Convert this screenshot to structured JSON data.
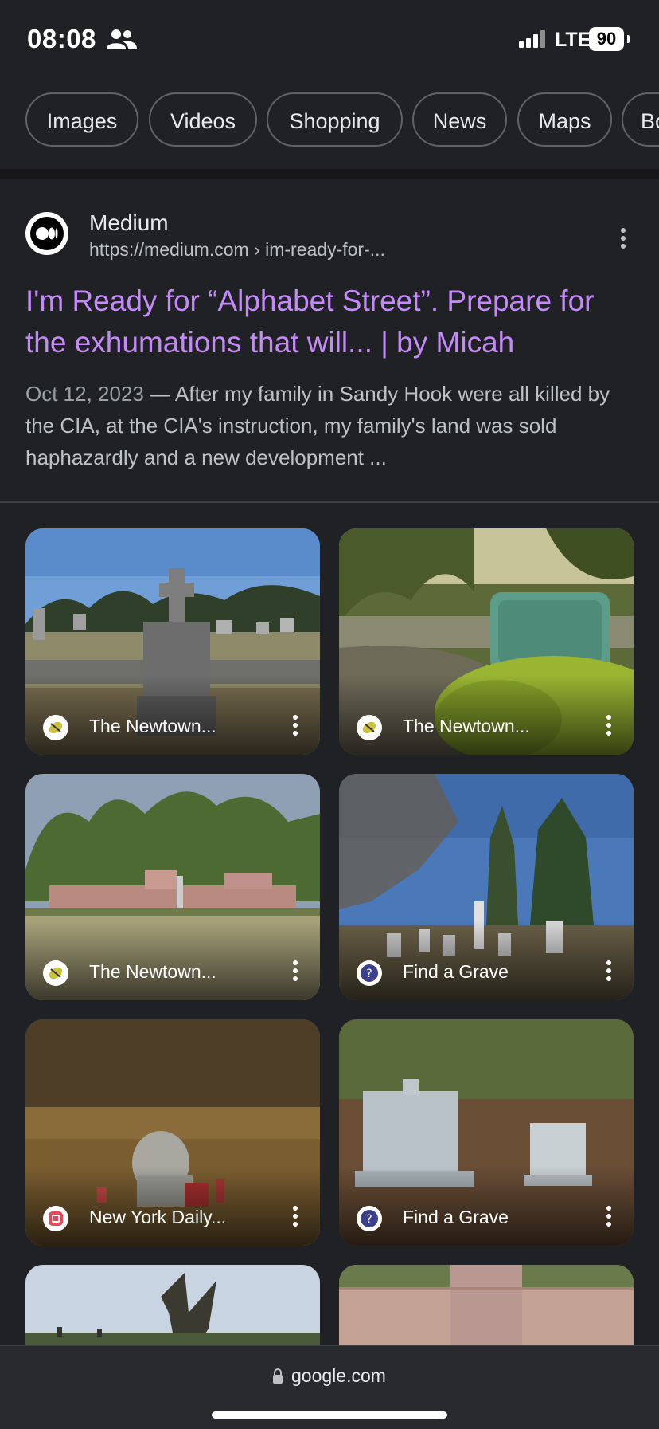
{
  "status_bar": {
    "time": "08:08",
    "network": "LTE",
    "battery": "90",
    "icons": [
      "people-icon",
      "signal-icon",
      "battery-icon"
    ]
  },
  "filter_chips": [
    "Images",
    "Videos",
    "Shopping",
    "News",
    "Maps",
    "Books"
  ],
  "result": {
    "site_name": "Medium",
    "site_url": "https://medium.com › im-ready-for-...",
    "title": "I'm Ready for “Alphabet Street”. Prepare for the exhumations that will... | by Micah",
    "date": "Oct 12, 2023",
    "snippet": " — After my family in Sandy Hook were all killed by the CIA, at the CIA's instruction, my family's land was sold haphazardly and a new development ...",
    "icons": [
      "medium-logo-icon",
      "more-vert-icon"
    ]
  },
  "images": [
    {
      "source": "The Newtown...",
      "icon": "newtown-bee-icon"
    },
    {
      "source": "The Newtown...",
      "icon": "newtown-bee-icon"
    },
    {
      "source": "The Newtown...",
      "icon": "newtown-bee-icon"
    },
    {
      "source": "Find a Grave",
      "icon": "find-a-grave-icon"
    },
    {
      "source": "New York Daily...",
      "icon": "ny-daily-news-icon"
    },
    {
      "source": "Find a Grave",
      "icon": "find-a-grave-icon"
    }
  ],
  "bottom_bar": {
    "url": "google.com",
    "icon": "lock-icon"
  },
  "colors": {
    "background": "#202124",
    "link_visited": "#c58af9",
    "snippet": "#bdc1c6"
  }
}
